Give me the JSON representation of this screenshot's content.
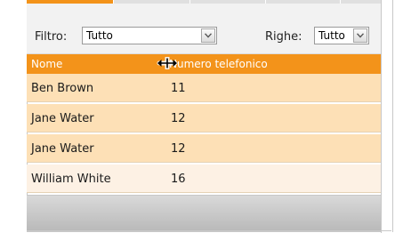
{
  "toolbar": {
    "filter_label": "Filtro:",
    "filter_value": "Tutto",
    "rows_label": "Righe:",
    "rows_value": "Tutto"
  },
  "table": {
    "columns": [
      "Nome",
      "Numero telefonico"
    ],
    "rows": [
      [
        "Ben Brown",
        "11"
      ],
      [
        "Jane Water",
        "12"
      ],
      [
        "Jane Water",
        "12"
      ],
      [
        "William White",
        "16"
      ]
    ]
  },
  "colors": {
    "accent": "#f3931a",
    "row_highlight": "#fde0b6",
    "row_normal": "#fdf1e4"
  },
  "icons": {
    "dropdown": "chevron-down-icon",
    "column_resize": "column-resize-icon"
  }
}
